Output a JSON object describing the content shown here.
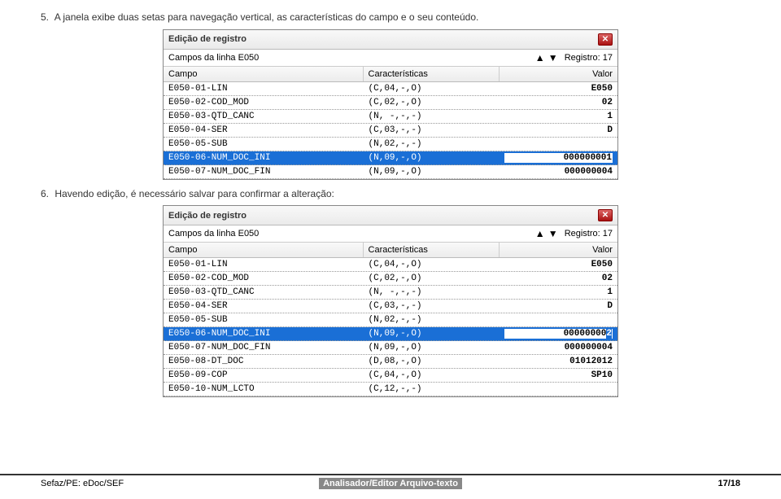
{
  "instruction1": {
    "num": "5.",
    "text": "A janela exibe duas setas para navegação vertical, as características do campo e o seu conteúdo."
  },
  "instruction2": {
    "num": "6.",
    "text": "Havendo edição, é necessário salvar para confirmar a alteração:"
  },
  "dialog": {
    "title": "Edição de registro",
    "sublabel": "Campos da linha E050",
    "registro": "Registro: 17",
    "headers": {
      "campo": "Campo",
      "carac": "Características",
      "valor": "Valor"
    }
  },
  "rows1": [
    {
      "campo": "E050-01-LIN",
      "carac": "(C,04,-,O)",
      "valor": "E050"
    },
    {
      "campo": "E050-02-COD_MOD",
      "carac": "(C,02,-,O)",
      "valor": "02"
    },
    {
      "campo": "E050-03-QTD_CANC",
      "carac": "(N, -,-,-)",
      "valor": "1"
    },
    {
      "campo": "E050-04-SER",
      "carac": "(C,03,-,-)",
      "valor": "D"
    },
    {
      "campo": "E050-05-SUB",
      "carac": "(N,02,-,-)",
      "valor": ""
    },
    {
      "campo": "E050-06-NUM_DOC_INI",
      "carac": "(N,09,-,O)",
      "valor": "000000001",
      "selected": true
    },
    {
      "campo": "E050-07-NUM_DOC_FIN",
      "carac": "(N,09,-,O)",
      "valor": "000000004"
    }
  ],
  "rows2": [
    {
      "campo": "E050-01-LIN",
      "carac": "(C,04,-,O)",
      "valor": "E050"
    },
    {
      "campo": "E050-02-COD_MOD",
      "carac": "(C,02,-,O)",
      "valor": "02"
    },
    {
      "campo": "E050-03-QTD_CANC",
      "carac": "(N, -,-,-)",
      "valor": "1"
    },
    {
      "campo": "E050-04-SER",
      "carac": "(C,03,-,-)",
      "valor": "D"
    },
    {
      "campo": "E050-05-SUB",
      "carac": "(N,02,-,-)",
      "valor": ""
    },
    {
      "campo": "E050-06-NUM_DOC_INI",
      "carac": "(N,09,-,O)",
      "valor_pre": "00000000",
      "valor_cur": "2",
      "selected": true,
      "editing": true
    },
    {
      "campo": "E050-07-NUM_DOC_FIN",
      "carac": "(N,09,-,O)",
      "valor": "000000004"
    },
    {
      "campo": "E050-08-DT_DOC",
      "carac": "(D,08,-,O)",
      "valor": "01012012"
    },
    {
      "campo": "E050-09-COP",
      "carac": "(C,04,-,O)",
      "valor": "SP10"
    },
    {
      "campo": "E050-10-NUM_LCTO",
      "carac": "(C,12,-,-)",
      "valor": ""
    }
  ],
  "footer": {
    "left": "Sefaz/PE: eDoc/SEF",
    "mid": "Analisador/Editor Arquivo-texto",
    "right": "17/18"
  }
}
